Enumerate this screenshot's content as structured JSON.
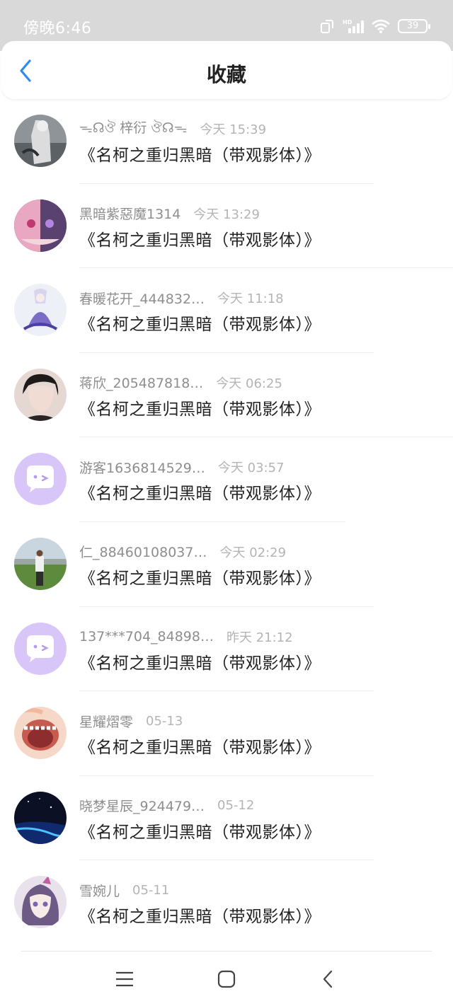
{
  "status_bar": {
    "time": "傍晚6:46",
    "battery": "39"
  },
  "header": {
    "title": "收藏"
  },
  "favorites": [
    {
      "user": "ᯓ☊ঔ 梓衍 ঔ☊ᯓ",
      "time": "今天 15:39",
      "title": "《名柯之重归黑暗（带观影体）》",
      "avatar": "photo-grey",
      "divider": 416
    },
    {
      "user": "黑暗紫惡魔1314",
      "time": "今天 13:29",
      "title": "《名柯之重归黑暗（带观影体）》",
      "avatar": "photo-pink",
      "divider": 528
    },
    {
      "user": "春暖花开_444832…",
      "time": "今天 11:18",
      "title": "《名柯之重归黑暗（带观影体）》",
      "avatar": "photo-white",
      "divider": 416
    },
    {
      "user": "蒋欣_205487818…",
      "time": "今天 06:25",
      "title": "《名柯之重归黑暗（带观影体）》",
      "avatar": "photo-dark",
      "divider": 528
    },
    {
      "user": "游客1636814529…",
      "time": "今天 03:57",
      "title": "《名柯之重归黑暗（带观影体）》",
      "avatar": "guest-placeholder",
      "divider": 376
    },
    {
      "user": "仁_88460108037…",
      "time": "今天 02:29",
      "title": "《名柯之重归黑暗（带观影体）》",
      "avatar": "photo-field",
      "divider": 416
    },
    {
      "user": "137***704_84898…",
      "time": "昨天 21:12",
      "title": "《名柯之重归黑暗（带观影体）》",
      "avatar": "guest-placeholder",
      "divider": 416
    },
    {
      "user": "星耀熠零",
      "time": "05-13",
      "title": "《名柯之重归黑暗（带观影体）》",
      "avatar": "photo-peach",
      "divider": 416
    },
    {
      "user": "晓梦星辰_924479…",
      "time": "05-12",
      "title": "《名柯之重归黑暗（带观影体）》",
      "avatar": "photo-night",
      "divider": 416
    },
    {
      "user": "雪婉儿",
      "time": "05-11",
      "title": "《名柯之重归黑暗（带观影体）》",
      "avatar": "photo-anime",
      "divider": 0
    }
  ],
  "nav_bar": {
    "buttons": [
      "menu-icon",
      "home-icon",
      "back-icon"
    ]
  },
  "colors": {
    "accent": "#2e8bf0",
    "guest_avatar": "#d8c6f9",
    "divider": "#eeeeee"
  }
}
